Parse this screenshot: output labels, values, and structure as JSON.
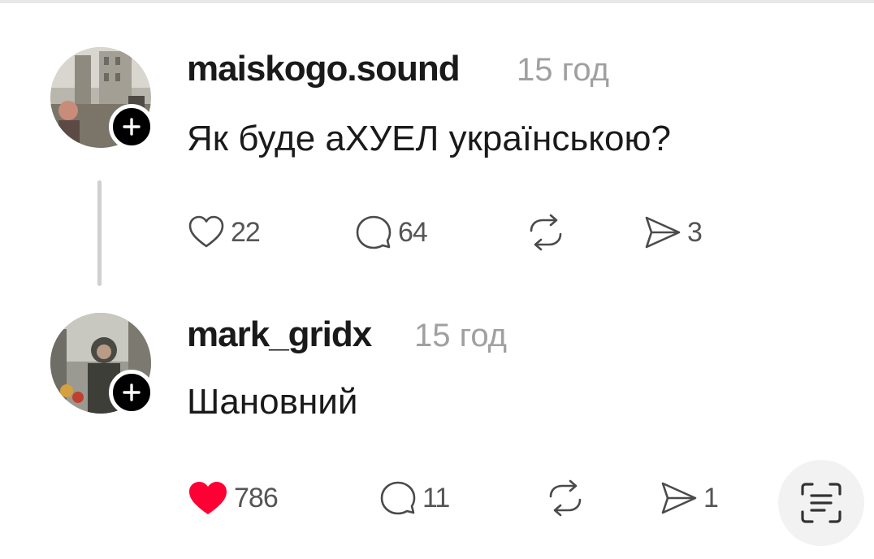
{
  "comments": [
    {
      "username": "maiskogo.sound",
      "time": "15 год",
      "text": "Як буде аХУЕЛ українською?",
      "likes": "22",
      "replies": "64",
      "shares": "3",
      "liked": false
    },
    {
      "username": "mark_gridx",
      "time": "15 год",
      "text": "Шановний",
      "likes": "786",
      "replies": "11",
      "shares": "1",
      "liked": true
    }
  ],
  "icons": {
    "follow": "plus-icon",
    "like": "heart-icon",
    "reply": "comment-icon",
    "repost": "repost-icon",
    "share": "send-icon",
    "scan": "text-scan-icon"
  },
  "colors": {
    "like_active": "#ff0034",
    "text": "#1a1a1a",
    "secondary": "#a0a0a0"
  }
}
